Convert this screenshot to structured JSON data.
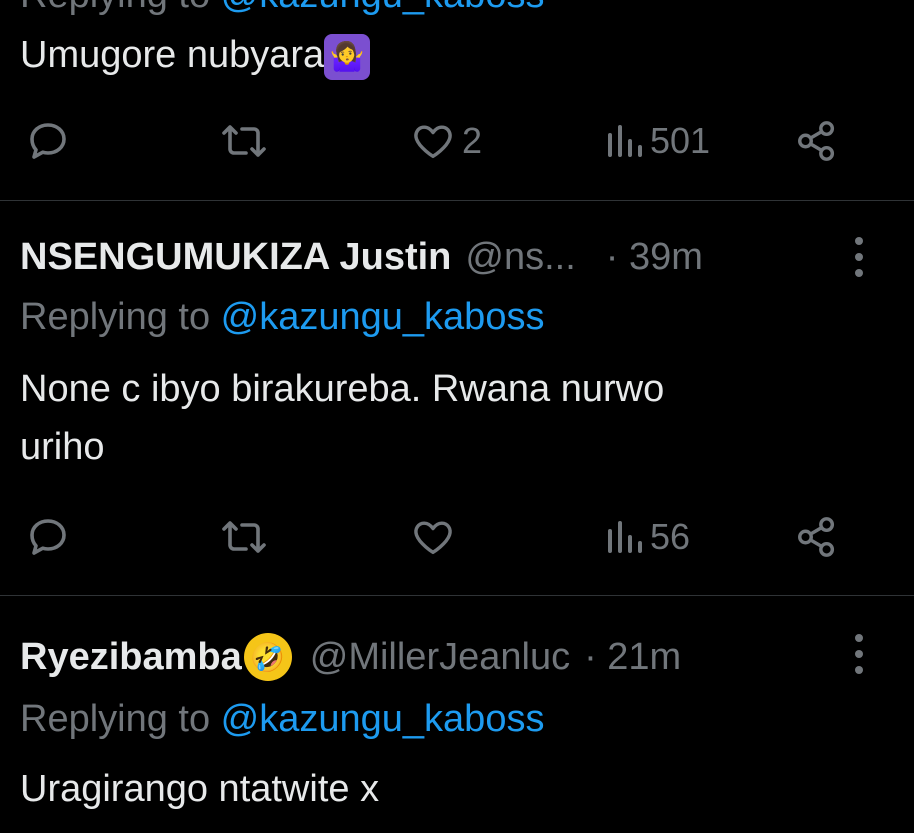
{
  "tweet_top": {
    "clipped_reply_mention": "@kazungu_kaboss",
    "text": "Umugore nubyara",
    "emoji": "🤷‍♀️",
    "likes": "2",
    "views": "501"
  },
  "tweet_2": {
    "name": "NSENGUMUKIZA Justin",
    "handle": "@ns...",
    "time": "· 39m",
    "replying_prefix": "Replying to ",
    "mention": "@kazungu_kaboss",
    "text_line1": "None c ibyo birakureba. Rwana nurwo",
    "text_line2": "uriho",
    "likes": "",
    "views": "56"
  },
  "tweet_3": {
    "name": "Ryezibamba",
    "emoji": "🤣",
    "handle": "@MillerJeanluc",
    "time": "· 21m",
    "replying_prefix": "Replying to ",
    "mention": "@kazungu_kaboss",
    "text": "Uragirango ntatwite x"
  },
  "colors": {
    "background": "#000000",
    "text": "#e7e9ea",
    "secondary": "#71767b",
    "link": "#1d9bf0",
    "divider": "#2f3336"
  },
  "icons": [
    "reply-icon",
    "retweet-icon",
    "like-icon",
    "views-icon",
    "share-icon",
    "more-icon"
  ]
}
